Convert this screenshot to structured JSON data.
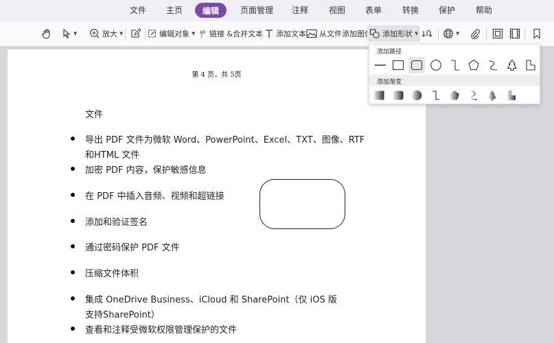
{
  "menu": {
    "items": [
      "文件",
      "主页",
      "编辑",
      "页面管理",
      "注释",
      "视图",
      "表单",
      "转换",
      "保护",
      "帮助"
    ],
    "active": "编辑"
  },
  "toolbar": {
    "zoom_label": "放大",
    "edit_object_label": "编辑对象",
    "link_merge_label": "链接 &合并文本",
    "add_text_label": "添加文本",
    "add_image_label": "从文件添加图像",
    "add_shape_label": "添加形状"
  },
  "shape_dropdown": {
    "path_section": "添加路径",
    "gradient_section": "添加渐变",
    "path_shapes": [
      "line-icon",
      "rectangle-icon",
      "rounded-rectangle-icon",
      "circle-icon",
      "step-line-icon",
      "pentagon-icon",
      "curve-icon",
      "tree-icon",
      "l-shape-icon"
    ],
    "gradient_shapes": [
      "gradient-rectangle-icon",
      "gradient-rounded-rectangle-icon",
      "gradient-circle-icon",
      "gradient-step-line-icon",
      "gradient-pentagon-icon",
      "gradient-curve-icon",
      "gradient-tree-icon",
      "gradient-l-shape-icon"
    ]
  },
  "document": {
    "page_number": "第 4 页，共 5页",
    "heading": "文件",
    "bullets": [
      [
        "导出 PDF 文件为微软 Word、PowerPoint、Excel、TXT、图像、RTF",
        "和HTML 文件"
      ],
      [
        "加密 PDF 内容，保护敏感信息"
      ],
      [
        "在 PDF 中插入音频、视频和超链接"
      ],
      [
        "添加和验证签名"
      ],
      [
        "通过密码保护 PDF 文件"
      ],
      [
        "压缩文件体积"
      ],
      [
        "集成 OneDrive Business、iCloud 和 SharePoint（仅 iOS 版",
        "支持SharePoint）"
      ],
      [
        "查看和注释受微软权限管理保护的文件"
      ]
    ]
  },
  "colors": {
    "active_tab": "#7a4aa6",
    "workspace": "#d5d7db",
    "menubar": "#eef0f3"
  }
}
